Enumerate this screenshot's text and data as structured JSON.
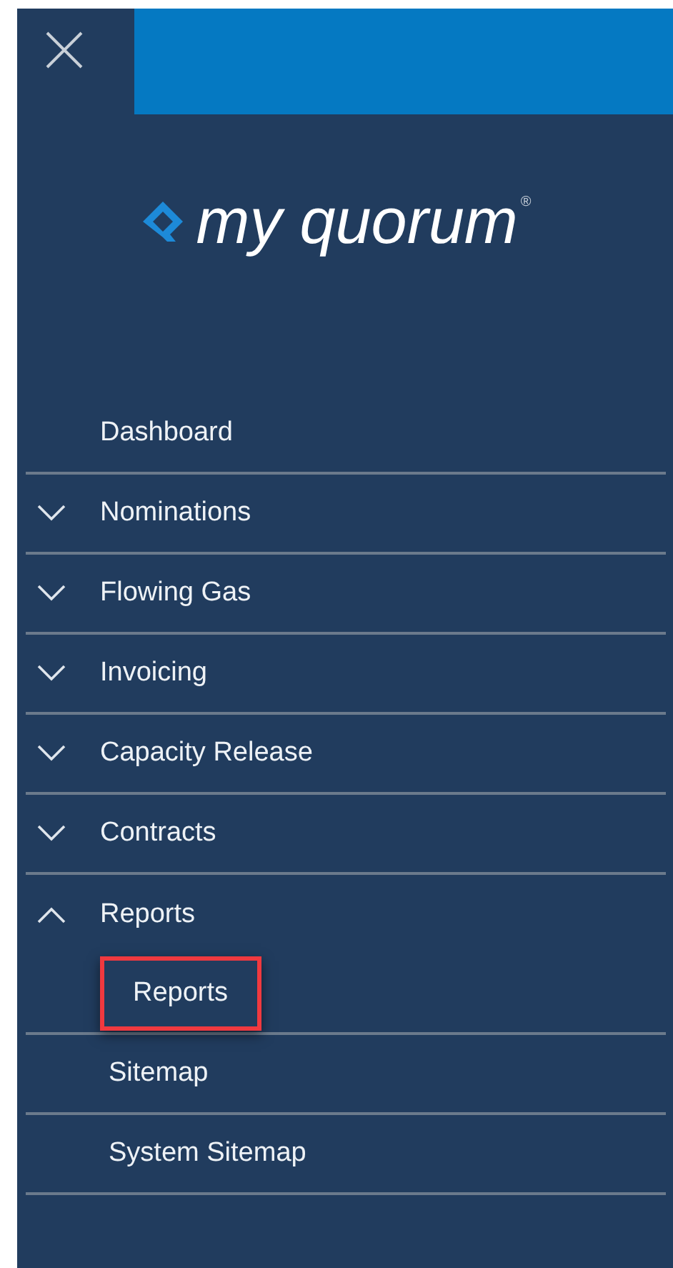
{
  "logo": {
    "text": "my quorum",
    "mark": "®"
  },
  "menu": [
    {
      "kind": "link",
      "label": "Dashboard"
    },
    {
      "kind": "group",
      "label": "Nominations",
      "expanded": false
    },
    {
      "kind": "group",
      "label": "Flowing Gas",
      "expanded": false
    },
    {
      "kind": "group",
      "label": "Invoicing",
      "expanded": false
    },
    {
      "kind": "group",
      "label": "Capacity Release",
      "expanded": false
    },
    {
      "kind": "group",
      "label": "Contracts",
      "expanded": false
    },
    {
      "kind": "group",
      "label": "Reports",
      "expanded": true,
      "children": [
        {
          "label": "Reports",
          "highlighted": true
        },
        {
          "label": "Sitemap",
          "highlighted": false
        },
        {
          "label": "System Sitemap",
          "highlighted": false
        }
      ]
    }
  ]
}
